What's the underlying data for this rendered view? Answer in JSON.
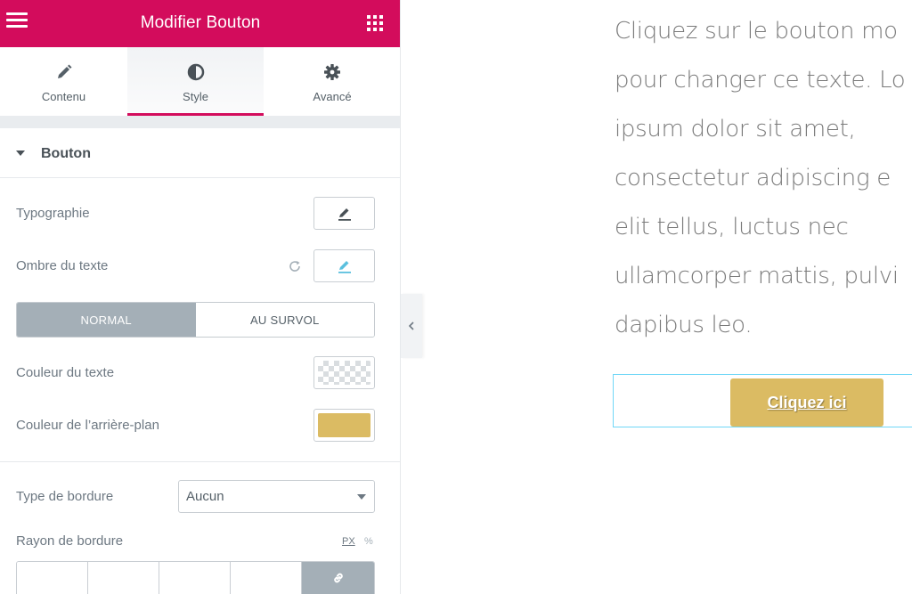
{
  "header": {
    "title": "Modifier Bouton"
  },
  "tabs": [
    {
      "label": "Contenu",
      "icon": "pencil-icon"
    },
    {
      "label": "Style",
      "icon": "half-circle-icon",
      "active": true
    },
    {
      "label": "Avancé",
      "icon": "gear-icon"
    }
  ],
  "section": {
    "title": "Bouton"
  },
  "controls": {
    "typography": "Typographie",
    "text_shadow": "Ombre du texte",
    "state_normal": "NORMAL",
    "state_hover": "AU SURVOL",
    "text_color": "Couleur du texte",
    "bg_color": "Couleur de l’arrière-plan",
    "bg_color_value": "#dbbb63",
    "border_type": "Type de bordure",
    "border_type_value": "Aucun",
    "border_radius": "Rayon de bordure",
    "unit_px": "PX",
    "unit_pct": "%"
  },
  "preview": {
    "lines": [
      "Cliquez sur le bouton mo",
      "pour changer ce texte. Lo",
      "ipsum dolor sit amet,",
      "consectetur adipiscing e",
      "elit tellus, luctus nec",
      "ullamcorper mattis, pulvi",
      "dapibus leo."
    ],
    "button_label": "Cliquez ici"
  },
  "colors": {
    "accent": "#d30c5c",
    "button": "#dbbb63",
    "selection": "#71d7f7"
  }
}
